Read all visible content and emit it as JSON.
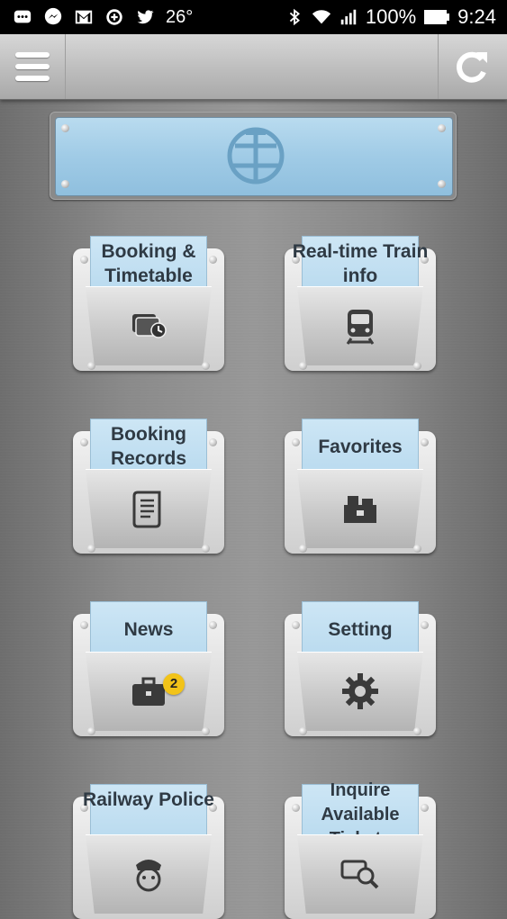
{
  "status_bar": {
    "temperature": "26°",
    "battery": "100%",
    "time": "9:24",
    "icons": [
      "chat-bubble-icon",
      "messenger-icon",
      "gmail-icon",
      "data-saver-icon",
      "twitter-icon",
      "bluetooth-icon",
      "wifi-icon",
      "signal-icon",
      "battery-icon"
    ]
  },
  "app_bar": {
    "menu_icon": "hamburger-menu-icon",
    "refresh_icon": "refresh-icon"
  },
  "header_plate": {
    "logo_icon": "railway-logo-icon"
  },
  "tiles": [
    {
      "label": "Booking & Timetable",
      "icon": "ticket-clock-icon"
    },
    {
      "label": "Real-time Train info",
      "icon": "train-icon"
    },
    {
      "label": "Booking Records",
      "icon": "scroll-icon"
    },
    {
      "label": "Favorites",
      "icon": "toolbox-icon"
    },
    {
      "label": "News",
      "icon": "briefcase-icon",
      "badge": "2"
    },
    {
      "label": "Setting",
      "icon": "gear-icon"
    },
    {
      "label": "Railway Police",
      "icon": "police-officer-icon"
    },
    {
      "label": "Inquire Available Tickets",
      "icon": "ticket-search-icon"
    }
  ]
}
